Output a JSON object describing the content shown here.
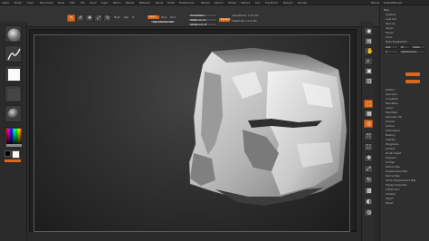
{
  "menu": {
    "items": [
      "Alpha",
      "Brush",
      "Color",
      "Document",
      "Draw",
      "Edit",
      "File",
      "Layer",
      "Light",
      "Macro",
      "Marker",
      "Material",
      "Movie",
      "Picker",
      "Preferences",
      "Render",
      "Stencil",
      "Stroke",
      "Texture",
      "Tool",
      "Transform",
      "Zplugin",
      "Zscript"
    ],
    "right_items": [
      "Menus",
      "DefaultZScript"
    ]
  },
  "top_shelf": {
    "buttons": [
      {
        "label": "Edit",
        "icon": "edit-icon",
        "active": true
      },
      {
        "label": "Draw",
        "icon": "draw-icon",
        "active": false
      },
      {
        "label": "Move",
        "icon": "move-icon",
        "active": false
      },
      {
        "label": "Scale",
        "icon": "scale-icon",
        "active": false
      },
      {
        "label": "Rotate",
        "icon": "rotate-icon",
        "active": false
      }
    ],
    "mrgb": "Mrgb",
    "rgb": "Rgb",
    "m": "M",
    "zadd": "Zadd",
    "zsub": "Zsub",
    "zcut": "Zcut",
    "focal_shift": "Focal Shift 0",
    "draw_size": "Draw Size 64",
    "dynamic": "Dynamic",
    "rgb_intensity": "Rgb Intensity 100",
    "z_intensity": "Z Intensity 25",
    "active_points": "ActivePoints: 1.172 Mil",
    "total_points": "TotalPoints: 1.172 Mil"
  },
  "tray": {
    "title": "Tool",
    "items": [
      "Lightbox",
      "Load Tool",
      "Save As",
      "Import",
      "Export",
      "Clone",
      "Make PolyMesh3D",
      "GoZ",
      "All",
      "Visible",
      "R",
      "Lightbox▸Tools"
    ],
    "subtools": [
      "SubTool",
      "Geometry",
      "ArrayMesh",
      "NanoMesh",
      "Layers",
      "FiberMesh",
      "Geometry HD",
      "Preview",
      "Surface",
      "Deformation",
      "Masking",
      "Visibility",
      "Polygroups",
      "Contact",
      "Morph Target",
      "Polypaint",
      "UV Map",
      "Texture Map",
      "Displacement Map",
      "Normal Map",
      "Vector Displacement Map",
      "Display Properties",
      "Unified Skin",
      "Initialize",
      "Import",
      "Export"
    ]
  },
  "colors": {
    "accent": "#d9681f",
    "background": "#2a2a2a"
  }
}
